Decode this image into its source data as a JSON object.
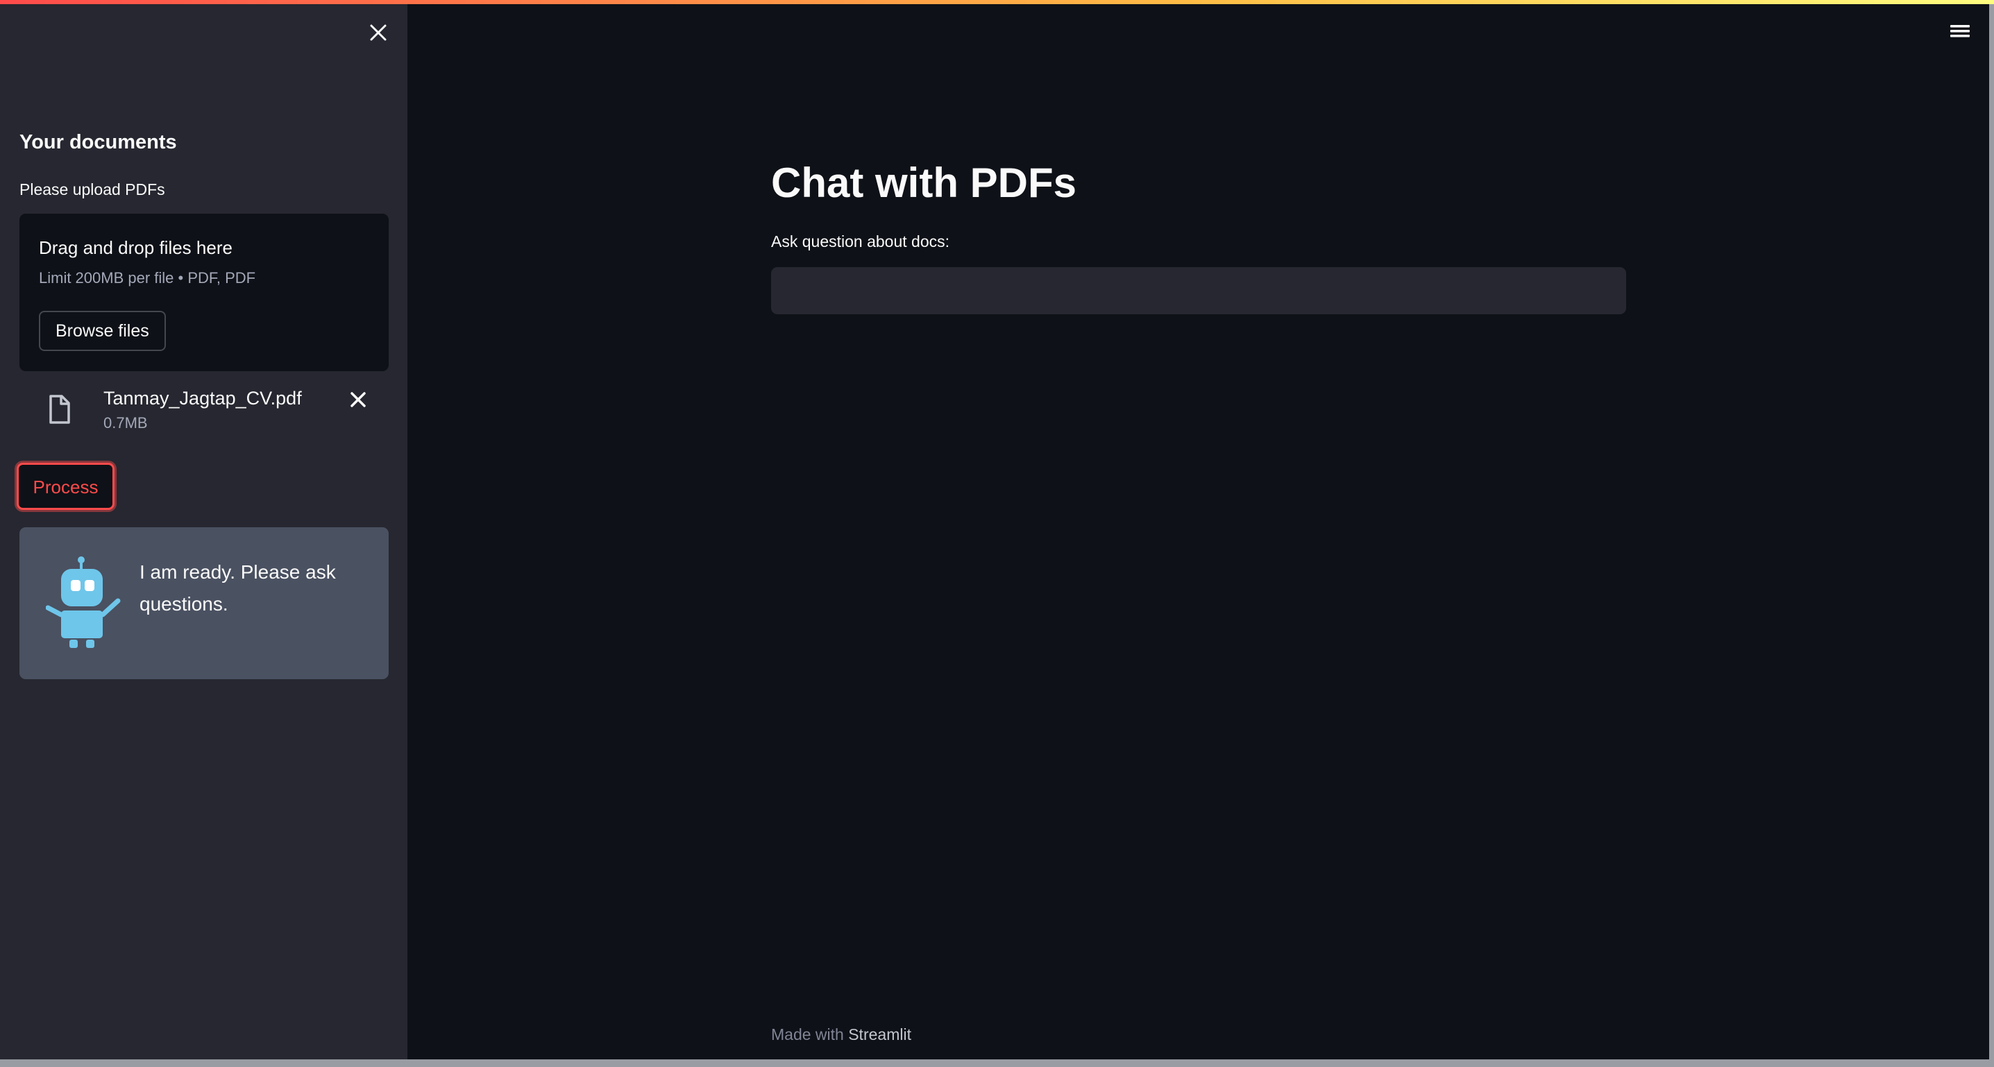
{
  "colors": {
    "background": "#0e1117",
    "sidebar": "#262730",
    "accent": "#ff4b4b",
    "bot_card": "#4a5161",
    "bot_color": "#6ec6ea"
  },
  "sidebar": {
    "close_icon": "close-icon",
    "title": "Your documents",
    "uploader": {
      "label": "Please upload PDFs",
      "dropzone_title": "Drag and drop files here",
      "limit_text": "Limit 200MB per file • PDF, PDF",
      "browse_label": "Browse files"
    },
    "uploaded_file": {
      "icon": "file-icon",
      "name": "Tanmay_Jagtap_CV.pdf",
      "size": "0.7MB",
      "remove_icon": "close-icon"
    },
    "process_label": "Process",
    "bot": {
      "icon": "robot-icon",
      "message": "I am ready. Please ask questions."
    }
  },
  "header": {
    "menu_icon": "hamburger-menu-icon"
  },
  "main": {
    "title": "Chat with PDFs",
    "question_label": "Ask question about docs:",
    "question_value": ""
  },
  "footer": {
    "prefix": "Made with",
    "link": "Streamlit"
  }
}
